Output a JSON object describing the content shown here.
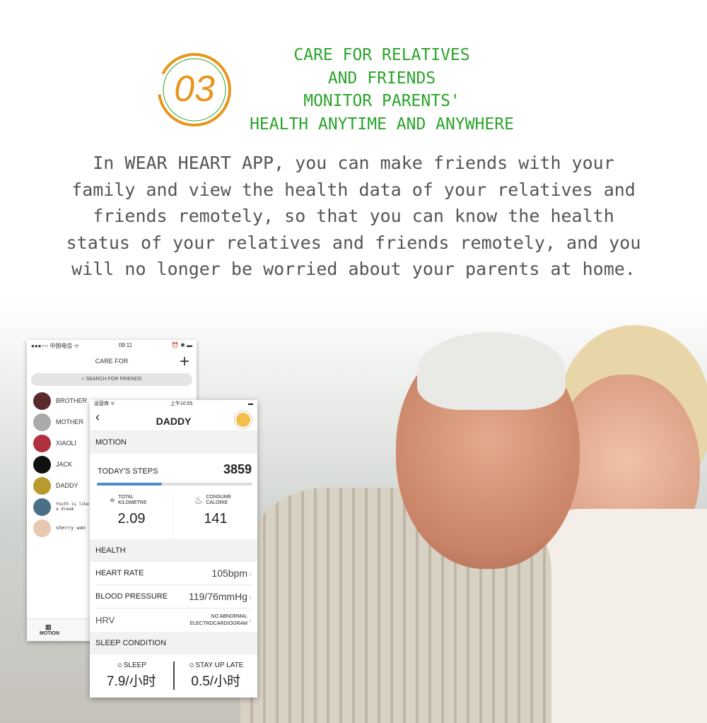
{
  "headline": {
    "number": "03",
    "lines": [
      "CARE FOR RELATIVES",
      "AND FRIENDS",
      "MONITOR PARENTS'",
      "HEALTH ANYTIME AND ANYWHERE"
    ],
    "color": "#2aa52a",
    "badge_color": "#e8951c"
  },
  "intro": [
    "In WEAR HEART APP, you can make friends with your",
    "family and view the health data of your relatives and",
    "friends remotely, so that you can know the health",
    "status of your relatives and friends remotely, and you",
    "will no longer be worried about your parents at home."
  ],
  "care_for": {
    "status": {
      "carrier": "●●●○○ 中国电信 ᯤ",
      "time": "09:11",
      "icons": "⏰ ✱ ▬"
    },
    "title": "CARE FOR",
    "add": "+",
    "search_placeholder": "SEARCH FOR FRIENDS",
    "friends": [
      {
        "name": "BROTHER"
      },
      {
        "name": "MOTHER"
      },
      {
        "name": "XIAOLI"
      },
      {
        "name": "JACK"
      },
      {
        "name": "DADDY"
      },
      {
        "name": "Youth is like a dream"
      },
      {
        "name": "sherry wan"
      }
    ],
    "tab": "MOTION"
  },
  "detail": {
    "status": {
      "carrier": "运营商 ᯤ",
      "time": "上午10:55"
    },
    "title": "DADDY",
    "motion_label": "MOTION",
    "steps_label": "TODAY'S STEPS",
    "steps": "3859",
    "steps_progress": 0.42,
    "km_label": "TOTAL KILOMETRE",
    "km": "2.09",
    "cal_label": "CONSUME CALORIE",
    "cal": "141",
    "health_label": "HEALTH",
    "rows": [
      {
        "label": "HEART RATE",
        "value": "105bpm"
      },
      {
        "label": "BLOOD PRESSURE",
        "value": "119/76mmHg"
      },
      {
        "label": "HRV",
        "value": "NO ABNORMAL ELECTROCARDIOGRAM"
      }
    ],
    "sleep_label": "SLEEP CONDITION",
    "sleep": {
      "label": "SLEEP",
      "value": "7.9/小时"
    },
    "late": {
      "label": "STAY UP LATE",
      "value": "0.5/小时"
    }
  }
}
